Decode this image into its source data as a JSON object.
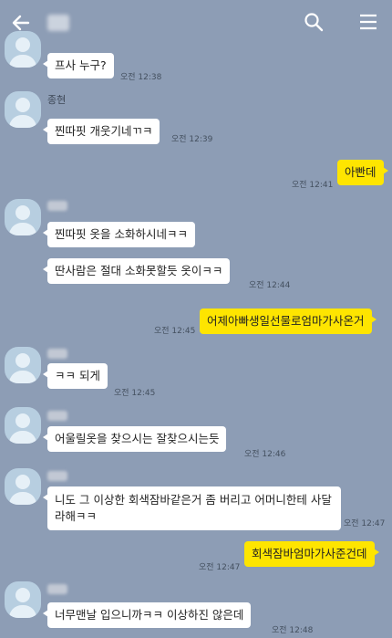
{
  "messages": [
    {
      "text": "프사 누구?",
      "time": "오전 12:38"
    },
    {
      "sender": "종현",
      "text": "찐따핏 개웃기네ㄲㅋ",
      "time": "오전 12:39"
    },
    {
      "text": "아빤데",
      "time": "오전 12:41"
    },
    {
      "text": "찐따핏 옷을 소화하시네ㅋㅋ"
    },
    {
      "text": "딴사람은 절대 소화못할듯 옷이ㅋㅋ",
      "time": "오전 12:44"
    },
    {
      "text": "어제아빠생일선물로엄마가사온거",
      "time": "오전 12:45"
    },
    {
      "text": "ㅋㅋ 되게",
      "time": "오전 12:45"
    },
    {
      "text": "어울릴옷을 찾으시는 잘찾으시는듯",
      "time": "오전 12:46"
    },
    {
      "text": "니도 그 이상한 회색잠바같은거 좀 버리고 어머니한테 사달라해ㅋㅋ",
      "time": "오전 12:47"
    },
    {
      "text": "회색잠바엄마가사준건데",
      "time": "오전 12:47"
    },
    {
      "text": "너무맨날 입으니까ㅋㅋ 이상하진 않은데",
      "time": "오전 12:48"
    }
  ]
}
